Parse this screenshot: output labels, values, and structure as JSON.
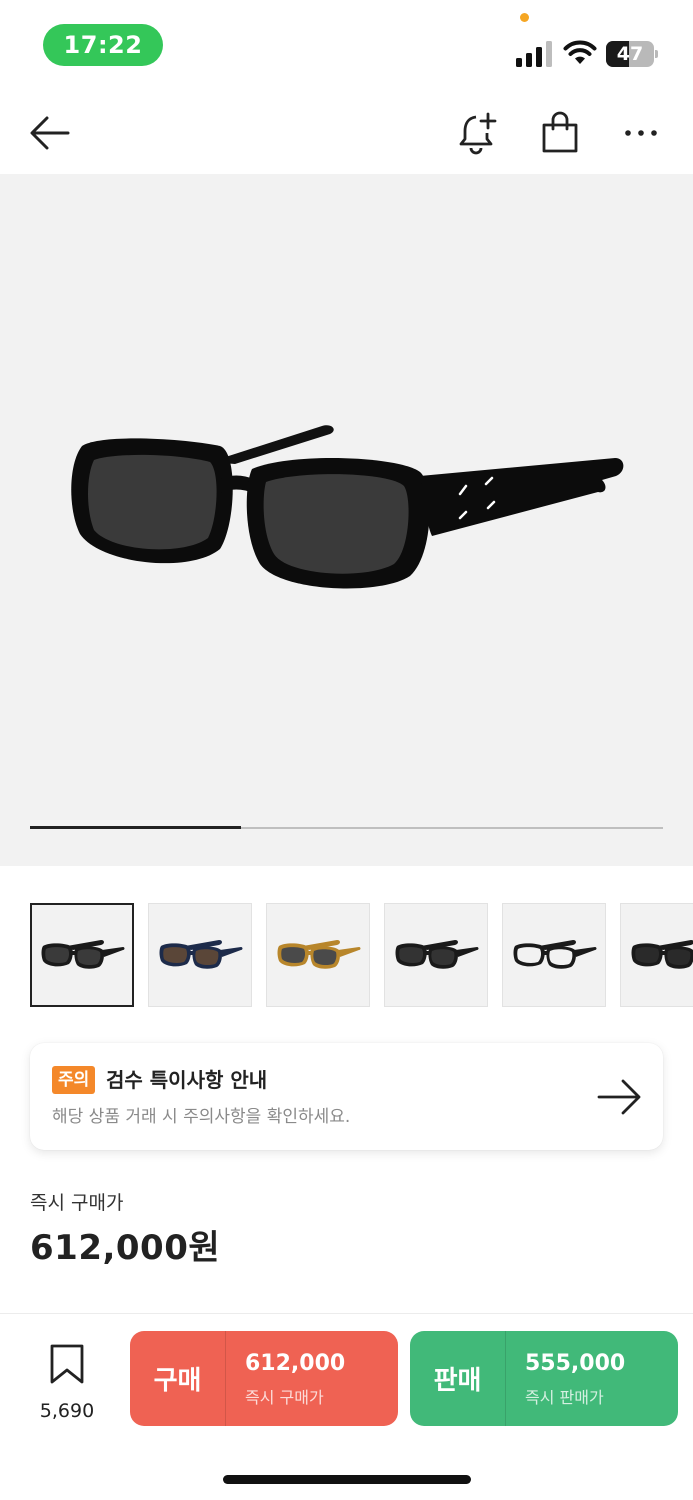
{
  "status_bar": {
    "time": "17:22",
    "battery_level": "47",
    "battery_fraction": 0.47
  },
  "nav": {
    "back_icon": "arrow-left-icon",
    "alert_icon": "bell-plus-icon",
    "cart_icon": "shopping-bag-icon",
    "more_icon": "ellipsis-icon"
  },
  "gallery": {
    "progress_fraction": 0.333,
    "active_index": 0,
    "thumbnails": [
      {
        "variant": "black",
        "frame": "#1a1a1a",
        "lens": "#3a3a3a"
      },
      {
        "variant": "navy",
        "frame": "#1d2b4a",
        "lens": "#5a4638"
      },
      {
        "variant": "tortoise",
        "frame": "#b8862b",
        "lens": "#4a4a4a"
      },
      {
        "variant": "black-silver",
        "frame": "#1a1a1a",
        "lens": "#333333"
      },
      {
        "variant": "black-clear",
        "frame": "#1a1a1a",
        "lens": "#f2f2f2"
      },
      {
        "variant": "black-dark",
        "frame": "#1a1a1a",
        "lens": "#2a2a2a"
      }
    ]
  },
  "notice": {
    "badge": "주의",
    "title": "검수 특이사항 안내",
    "subtitle": "해당 상품 거래 시 주의사항을 확인하세요.",
    "badge_color": "#f4882a"
  },
  "price": {
    "label": "즉시 구매가",
    "value": "612,000원"
  },
  "bottom": {
    "wish_count": "5,690",
    "buy": {
      "label": "구매",
      "price": "612,000",
      "sub": "즉시 구매가",
      "color": "#ef6253"
    },
    "sell": {
      "label": "판매",
      "price": "555,000",
      "sub": "즉시 판매가",
      "color": "#41b979"
    }
  }
}
